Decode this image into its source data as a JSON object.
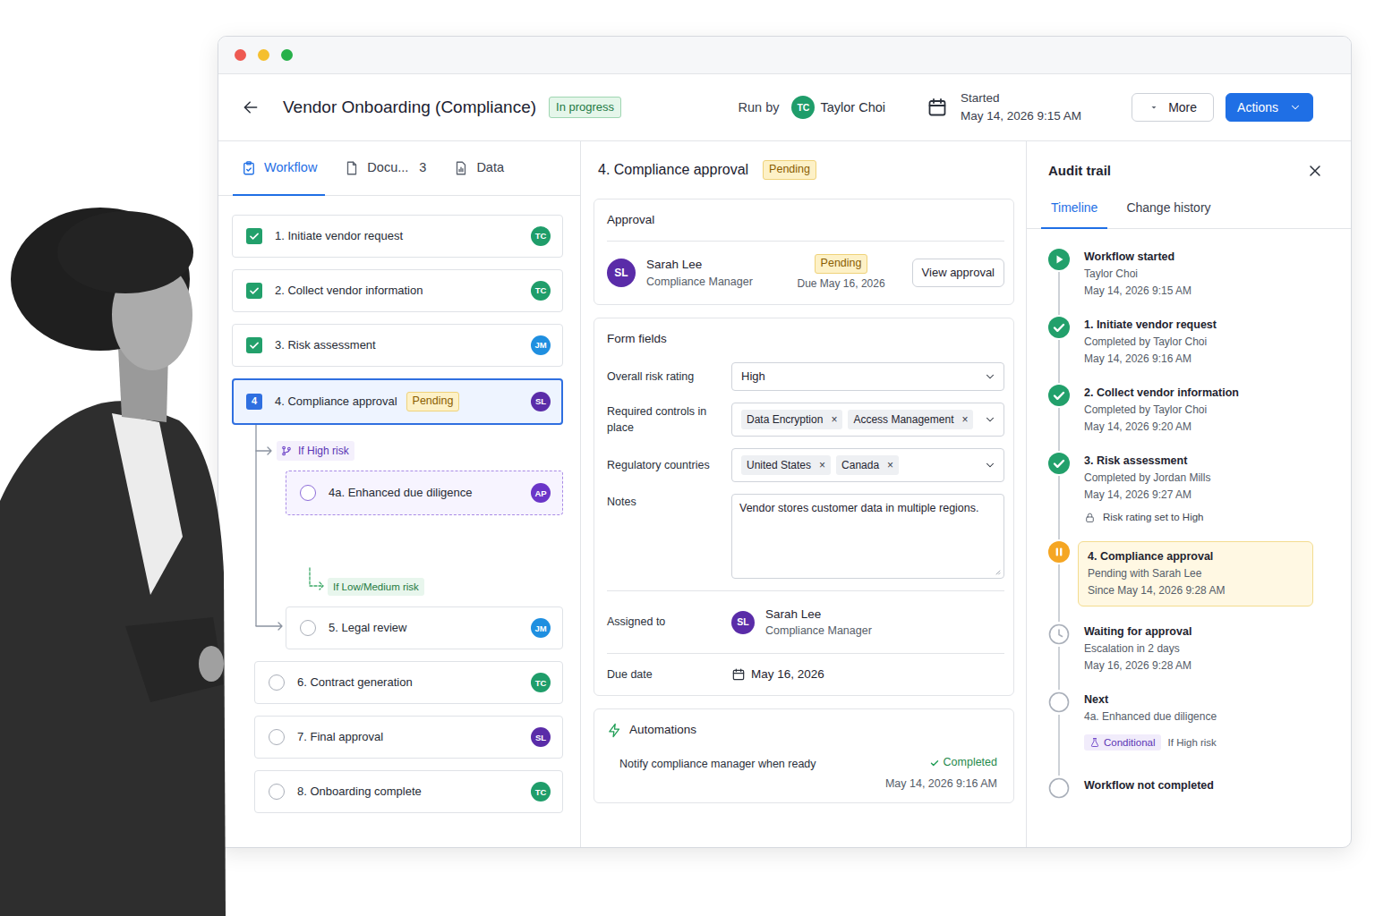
{
  "window": {
    "title": "Vendor Onboarding (Compliance)",
    "status": "In progress"
  },
  "header": {
    "run_by_label": "Run by",
    "runner": {
      "initials": "TC",
      "name": "Taylor Choi",
      "color": "#1f9d6a"
    },
    "started_label": "Started",
    "started": "May 14, 2026 9:15 AM",
    "buttons": [
      {
        "label": "More",
        "primary": false
      },
      {
        "label": "Actions",
        "primary": true
      }
    ]
  },
  "left_tabs": [
    {
      "label": "Workflow",
      "selected": true
    },
    {
      "label": "Docu...",
      "count": "3",
      "selected": false
    },
    {
      "label": "Data",
      "selected": false
    }
  ],
  "workflow": {
    "steps": [
      {
        "label": "1. Initiate vendor request",
        "checked": true,
        "selected": false,
        "assignee": "TC",
        "color": "#1f9d6a"
      },
      {
        "label": "2. Collect vendor information",
        "checked": true,
        "selected": false,
        "assignee": "TC",
        "color": "#1f9d6a"
      },
      {
        "label": "3. Risk assessment",
        "checked": true,
        "selected": false,
        "assignee": "JM",
        "color": "#1f8fe0"
      },
      {
        "label": "4. Compliance approval",
        "checked": false,
        "selected": true,
        "number": "4",
        "badge": "Pending",
        "assignee": "SL",
        "color": "#5a2ca8"
      }
    ],
    "branches": [
      {
        "kind": "high",
        "condition": "If High risk",
        "step": {
          "label": "4a. Enhanced due diligence",
          "checked": false,
          "selected": false,
          "assignee": "AP",
          "color": "#6a35c8"
        }
      },
      {
        "kind": "low",
        "condition": "If Low/Medium risk",
        "step": {
          "label": "5. Legal review",
          "checked": false,
          "selected": false,
          "assignee": "JM",
          "color": "#1f8fe0"
        }
      }
    ],
    "rest": [
      {
        "label": "6. Contract generation",
        "checked": false,
        "selected": false,
        "assignee": "TC",
        "color": "#1f9d6a"
      },
      {
        "label": "7. Final approval",
        "checked": false,
        "selected": false,
        "assignee": "SL",
        "color": "#5a2ca8"
      },
      {
        "label": "8. Onboarding complete",
        "checked": false,
        "selected": false,
        "assignee": "TC",
        "color": "#1f9d6a"
      }
    ]
  },
  "detail": {
    "title": "4. Compliance approval",
    "status": "Pending",
    "approval": {
      "heading": "Approval",
      "approver": {
        "initials": "SL",
        "name": "Sarah Lee",
        "role": "Compliance Manager",
        "color": "#5a2ca8"
      },
      "status": "Pending",
      "due": "Due May 16, 2026",
      "button": "View approval"
    },
    "form": {
      "heading": "Form fields",
      "fields": [
        {
          "kind": "select",
          "label": "Overall risk rating",
          "value": "High"
        },
        {
          "kind": "multi",
          "label": "Required controls in place",
          "chips": [
            {
              "label": "Data Encryption",
              "remove": "×"
            },
            {
              "label": "Access Management",
              "remove": "×"
            }
          ]
        },
        {
          "kind": "multi",
          "label": "Regulatory countries",
          "chips": [
            {
              "label": "United States",
              "remove": "×"
            },
            {
              "label": "Canada",
              "remove": "×"
            }
          ]
        },
        {
          "kind": "textarea",
          "label": "Notes",
          "value": "Vendor stores customer data in multiple regions."
        }
      ],
      "assigned": {
        "label": "Assigned to",
        "initials": "SL",
        "name": "Sarah Lee",
        "role": "Compliance Manager",
        "color": "#5a2ca8"
      },
      "due": {
        "label": "Due date",
        "value": "May 16, 2026"
      }
    },
    "automations": {
      "heading": "Automations",
      "items": [
        {
          "label": "Notify compliance manager when ready",
          "status": "Completed",
          "done": true,
          "time": "May 14, 2026 9:16 AM"
        }
      ]
    }
  },
  "audit": {
    "title": "Audit trail",
    "tabs": [
      {
        "label": "Timeline",
        "selected": true
      },
      {
        "label": "Change history",
        "selected": false
      }
    ],
    "events": [
      {
        "kind": "start",
        "title": "Workflow started",
        "lines": [
          "Taylor Choi",
          "May 14, 2026 9:15 AM"
        ]
      },
      {
        "kind": "done",
        "title": "1. Initiate vendor request",
        "lines": [
          "Completed by Taylor Choi",
          "May 14, 2026 9:16 AM"
        ]
      },
      {
        "kind": "done",
        "title": "2. Collect vendor information",
        "lines": [
          "Completed by Taylor Choi",
          "May 14, 2026 9:20 AM"
        ]
      },
      {
        "kind": "done",
        "title": "3. Risk assessment",
        "lines": [
          "Completed by Jordan Mills",
          "May 14, 2026 9:27 AM"
        ],
        "note": "Risk rating set to High"
      },
      {
        "kind": "current",
        "title": "4. Compliance approval",
        "lines": [
          "Pending with Sarah Lee",
          "Since May 14, 2026 9:28 AM"
        ]
      },
      {
        "kind": "waiting",
        "title": "Waiting for approval",
        "lines": [
          "Escalation in 2 days",
          "May 16, 2026 9:28 AM"
        ]
      },
      {
        "kind": "next",
        "title": "Next",
        "lines": [
          "4a. Enhanced due diligence"
        ],
        "tag": "Conditional",
        "condition": "If High risk"
      },
      {
        "kind": "end",
        "title": "Workflow not completed",
        "lines": []
      }
    ]
  }
}
